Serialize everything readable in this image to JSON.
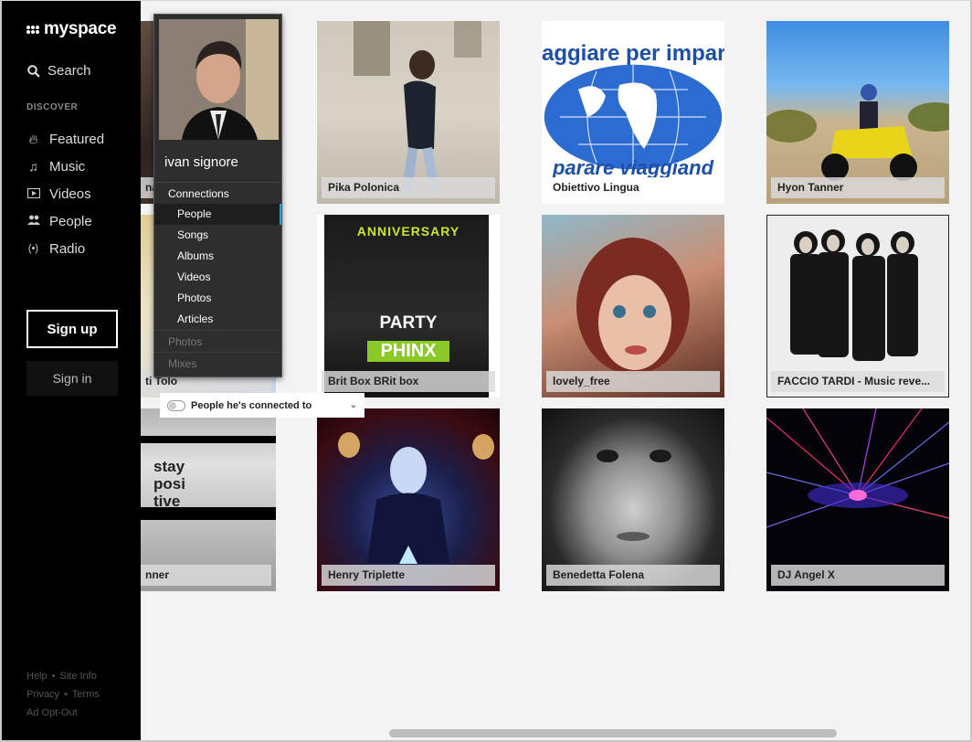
{
  "logo": {
    "text": "myspace"
  },
  "nav": {
    "search_label": "Search",
    "discover_label": "DISCOVER",
    "items": [
      {
        "label": "Featured",
        "icon": "flame-icon"
      },
      {
        "label": "Music",
        "icon": "music-note-icon"
      },
      {
        "label": "Videos",
        "icon": "video-icon"
      },
      {
        "label": "People",
        "icon": "people-icon"
      },
      {
        "label": "Radio",
        "icon": "radio-icon"
      }
    ],
    "signup_label": "Sign up",
    "signin_label": "Sign in"
  },
  "footer": {
    "help": "Help",
    "site_info": "Site Info",
    "privacy": "Privacy",
    "terms": "Terms",
    "ad_opt_out": "Ad Opt-Out",
    "separator": "•"
  },
  "popup": {
    "name": "ivan signore",
    "section_header": "Connections",
    "items": [
      "People",
      "Songs",
      "Albums",
      "Videos",
      "Photos",
      "Articles"
    ],
    "active_item": "People",
    "dimmed": [
      "Photos",
      "Mixes"
    ]
  },
  "toggle": {
    "label": "People he's connected to"
  },
  "tiles": [
    {
      "caption": "na"
    },
    {
      "caption": "Pika Polonica"
    },
    {
      "caption": "Obiettivo Lingua",
      "image_text_top": "aggiare per impara",
      "image_text_bottom": "parare viaggiand"
    },
    {
      "caption": "Hyon Tanner"
    },
    {
      "caption": "ti Tolo"
    },
    {
      "caption": "Brit Box BRit box",
      "image_text_top": "ANNIVERSARY",
      "image_text_mid": "PARTY",
      "image_text_bottom": "PHINX"
    },
    {
      "caption": "lovely_free"
    },
    {
      "caption": "FACCIO TARDI - Music reve..."
    },
    {
      "caption": "nner",
      "image_text": "stay posi tive"
    },
    {
      "caption": "Henry Triplette"
    },
    {
      "caption": "Benedetta Folena"
    },
    {
      "caption": "DJ Angel X"
    }
  ]
}
